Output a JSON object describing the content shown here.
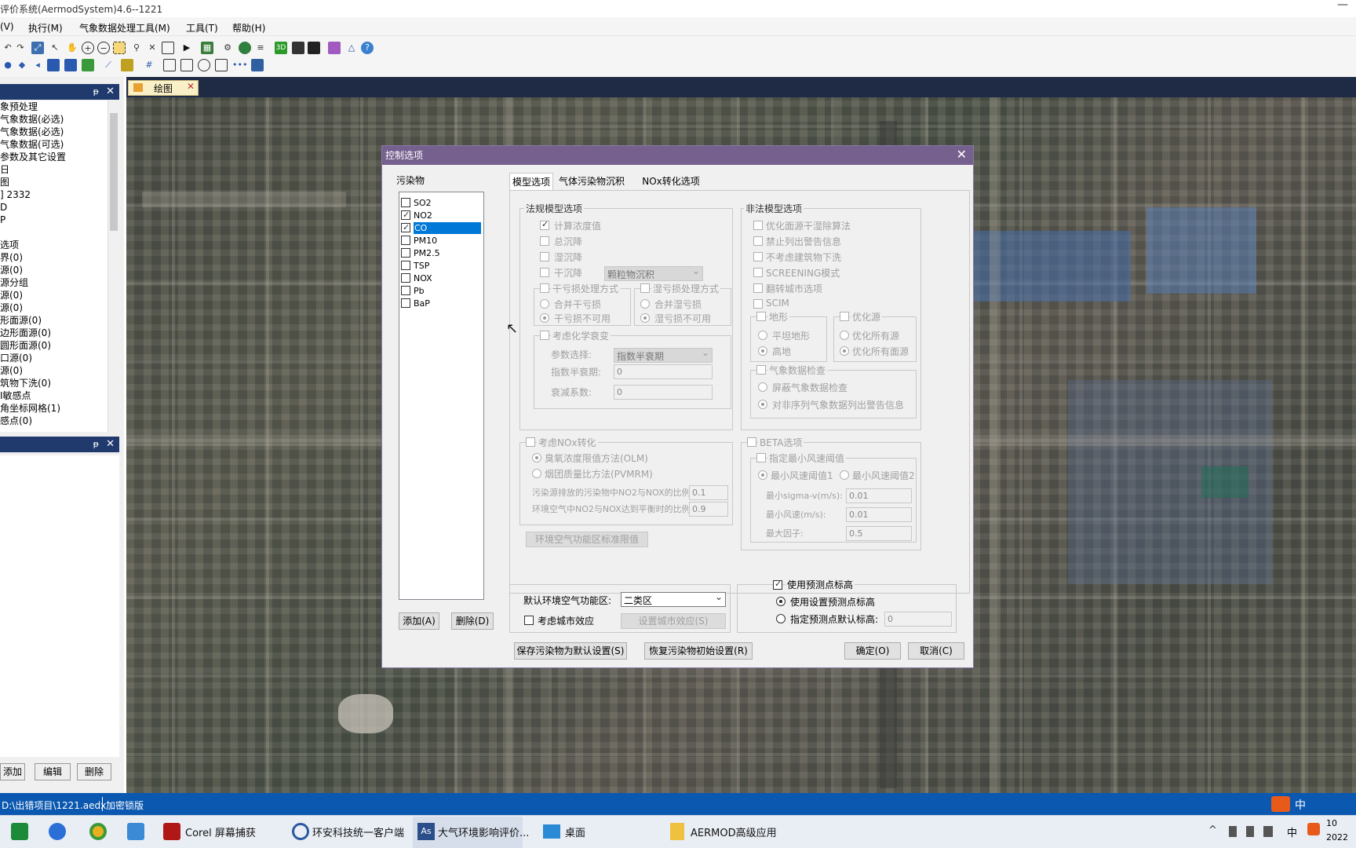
{
  "app": {
    "title": "评价系统(AermodSystem)4.6--1221"
  },
  "menu": [
    "(V)",
    "执行(M)",
    "气象数据处理工具(M)",
    "工具(T)",
    "帮助(H)"
  ],
  "left_panel": {
    "tree": [
      "象预处理",
      "气象数据(必选)",
      "气象数据(必选)",
      "气象数据(可选)",
      "参数及其它设置",
      "日",
      "图",
      "] 2332",
      "D",
      "P",
      "",
      "选项",
      "界(0)",
      "源(0)",
      "源分组",
      "源(0)",
      "源(0)",
      "形面源(0)",
      "边形面源(0)",
      "圆形面源(0)",
      "口源(0)",
      "源(0)",
      "筑物下洗(0)",
      "Ⅰ敏感点",
      "角坐标网格(1)",
      "感点(0)"
    ],
    "buttons": {
      "add": "添加",
      "edit": "编辑",
      "delete": "删除"
    }
  },
  "map_tab": {
    "label": "绘图"
  },
  "status": {
    "path": "D:\\出错项目\\1221.aedx",
    "lock": "加密锁版"
  },
  "taskbar": {
    "items": [
      "Corel 屏幕捕获",
      "环安科技统一客户端",
      "大气环境影响评价...",
      "桌面",
      "AERMOD高级应用"
    ],
    "tray": {
      "ime": "中",
      "year": "2022",
      "time_hint": "10"
    }
  },
  "dialog": {
    "title": "控制选项",
    "pollutants": {
      "label": "污染物",
      "items": [
        {
          "name": "SO2",
          "checked": false
        },
        {
          "name": "NO2",
          "checked": true
        },
        {
          "name": "CO",
          "checked": true,
          "selected": true
        },
        {
          "name": "PM10",
          "checked": false
        },
        {
          "name": "PM2.5",
          "checked": false
        },
        {
          "name": "TSP",
          "checked": false
        },
        {
          "name": "NOX",
          "checked": false
        },
        {
          "name": "Pb",
          "checked": false
        },
        {
          "name": "BaP",
          "checked": false
        }
      ],
      "add": "添加(A)",
      "delete": "删除(D)"
    },
    "tabs": [
      "模型选项",
      "气体污染物沉积",
      "NOx转化选项"
    ],
    "reg": {
      "title": "法规模型选项",
      "calc_conc": "计算浓度值",
      "total_dep": "总沉降",
      "wet_dep": "湿沉降",
      "dry_dep": "干沉降",
      "dry_dep_type": "颗粒物沉积",
      "dry_loss_title": "干亏损处理方式",
      "merge_dry": "合并干亏损",
      "dry_unavail": "干亏损不可用",
      "wet_loss_title": "湿亏损处理方式",
      "merge_wet": "合并湿亏损",
      "wet_unavail": "湿亏损不可用",
      "chem_title": "考虑化学衰变",
      "param_label": "参数选择:",
      "param_value": "指数半衰期",
      "halflife_label": "指数半衰期:",
      "halflife_value": "0",
      "decay_label": "衰减系数:",
      "decay_value": "0"
    },
    "nonreg": {
      "title": "非法模型选项",
      "items": [
        "优化面源干湿除算法",
        "禁止列出警告信息",
        "不考虑建筑物下洗",
        "SCREENING模式",
        "翻转城市选项",
        "SCIM"
      ],
      "terrain_title": "地形",
      "flat": "平坦地形",
      "elevated": "高地",
      "opt_title": "优化源",
      "opt_all": "优化所有源",
      "opt_area": "优化所有面源",
      "met_title": "气象数据检查",
      "met_mask": "屏蔽气象数据检查",
      "met_warn": "对非序列气象数据列出警告信息"
    },
    "nox": {
      "title": "考虑NOx转化",
      "olm": "臭氧浓度限值方法(OLM)",
      "pvmrm": "烟团质量比方法(PVMRM)",
      "ratio1_label": "污染源排放的污染物中NO2与NOX的比例:",
      "ratio1": "0.1",
      "ratio2_label": "环境空气中NO2与NOX达到平衡时的比例:",
      "ratio2": "0.9",
      "std_btn": "环境空气功能区标准限值"
    },
    "beta": {
      "title": "BETA选项",
      "minwind_title": "指定最小风速阈值",
      "t1": "最小风速阈值1",
      "t2": "最小风速阈值2",
      "sigma_label": "最小sigma-v(m/s):",
      "sigma": "0.01",
      "minwind_label": "最小风速(m/s):",
      "minwind": "0.01",
      "maxfactor_label": "最大因子:",
      "maxfactor": "0.5"
    },
    "zone": {
      "label": "默认环境空气功能区:",
      "value": "二类区",
      "urban": "考虑城市效应",
      "urban_btn": "设置城市效应(S)"
    },
    "elev": {
      "title": "使用预测点标高",
      "use_set": "使用设置预测点标高",
      "specify": "指定预测点默认标高:",
      "value": "0"
    },
    "buttons": {
      "save_default": "保存污染物为默认设置(S)",
      "restore": "恢复污染物初始设置(R)",
      "ok": "确定(O)",
      "cancel": "取消(C)"
    }
  }
}
